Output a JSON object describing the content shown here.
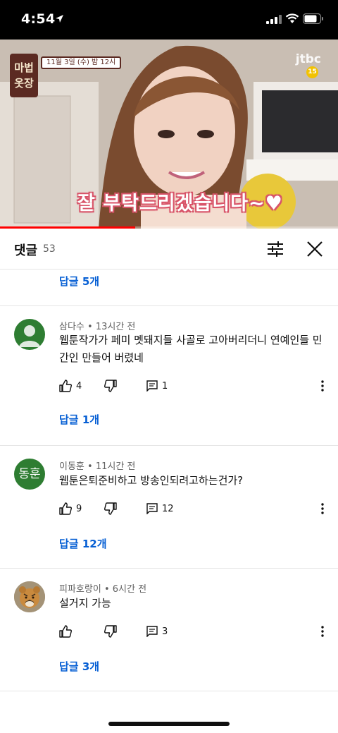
{
  "status_bar": {
    "time": "4:54"
  },
  "video": {
    "show_logo": "마법\n옷장",
    "airtime": "11월 3일 (수) 밤 12시",
    "channel": "jtbc",
    "age_rating": "15",
    "caption": "잘 부탁드리겠습니다~♥",
    "progress": 0.4
  },
  "comments_panel": {
    "title": "댓글",
    "count": "53"
  },
  "top_reply_link": "답글 5개",
  "comments": [
    {
      "author": "삼다수",
      "time": "13시간 전",
      "text_lines": [
        "웹툰작가가 페미 멧돼지들 사골로 고아버리더니 연예인들 민",
        "간인 만들어 버렸네"
      ],
      "likes": "4",
      "replies_count": "1",
      "reply_link": "답글 1개",
      "avatar": {
        "type": "default",
        "color": "#2e7d32"
      }
    },
    {
      "author": "이동훈",
      "time": "11시간 전",
      "text_lines": [
        "웹툰은퇴준비하고 방송인되려고하는건가?"
      ],
      "likes": "9",
      "replies_count": "12",
      "reply_link": "답글 12개",
      "avatar": {
        "type": "text",
        "text": "동훈",
        "color": "#2e7d32"
      }
    },
    {
      "author": "피파호랑이",
      "time": "6시간 전",
      "text_lines": [
        "설거지 가능"
      ],
      "likes": "",
      "replies_count": "3",
      "reply_link": "답글 3개",
      "avatar": {
        "type": "image",
        "subject": "tiger"
      }
    }
  ],
  "icons": {
    "like": "thumbs-up-icon",
    "dislike": "thumbs-down-icon",
    "reply": "comment-icon",
    "more": "more-vert-icon",
    "sort": "sliders-icon",
    "close": "close-icon"
  },
  "colors": {
    "link_blue": "#065fd4",
    "progress_red": "#ff0000",
    "avatar_green": "#2e7d32"
  }
}
